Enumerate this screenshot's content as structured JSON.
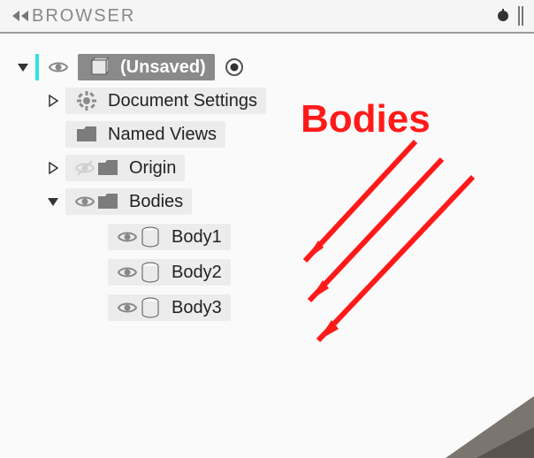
{
  "header": {
    "title": "BROWSER"
  },
  "root": {
    "label": "(Unsaved)"
  },
  "nodes": {
    "doc_settings": {
      "label": "Document Settings"
    },
    "named_views": {
      "label": "Named Views"
    },
    "origin": {
      "label": "Origin"
    },
    "bodies": {
      "label": "Bodies"
    }
  },
  "bodies_children": [
    {
      "label": "Body1"
    },
    {
      "label": "Body2"
    },
    {
      "label": "Body3"
    }
  ],
  "annotation": {
    "label": "Bodies"
  }
}
